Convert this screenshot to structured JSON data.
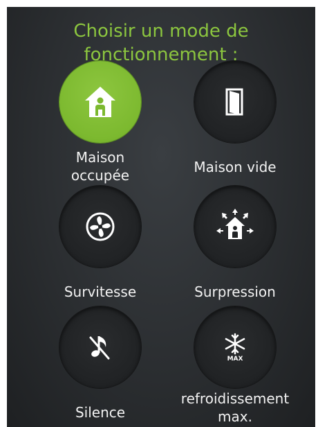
{
  "header": {
    "title": "Choisir un mode de\nfonctionnement :"
  },
  "colors": {
    "accent": "#8cc63f",
    "panel_bg": "#2b2e31",
    "label": "#f2f2f2"
  },
  "modes": [
    {
      "label": "Maison\noccupée",
      "icon": "house-person-icon",
      "active": true
    },
    {
      "label": "Maison vide",
      "icon": "door-icon",
      "active": false
    },
    {
      "label": "Survitesse",
      "icon": "fan-icon",
      "active": false
    },
    {
      "label": "Surpression",
      "icon": "house-pressure-icon",
      "active": false
    },
    {
      "label": "Silence",
      "icon": "music-muted-icon",
      "active": false
    },
    {
      "label": "refroidissement\nmax.",
      "icon": "snowflake-max-icon",
      "active": false
    }
  ],
  "icon_text": {
    "max": "MAX"
  }
}
